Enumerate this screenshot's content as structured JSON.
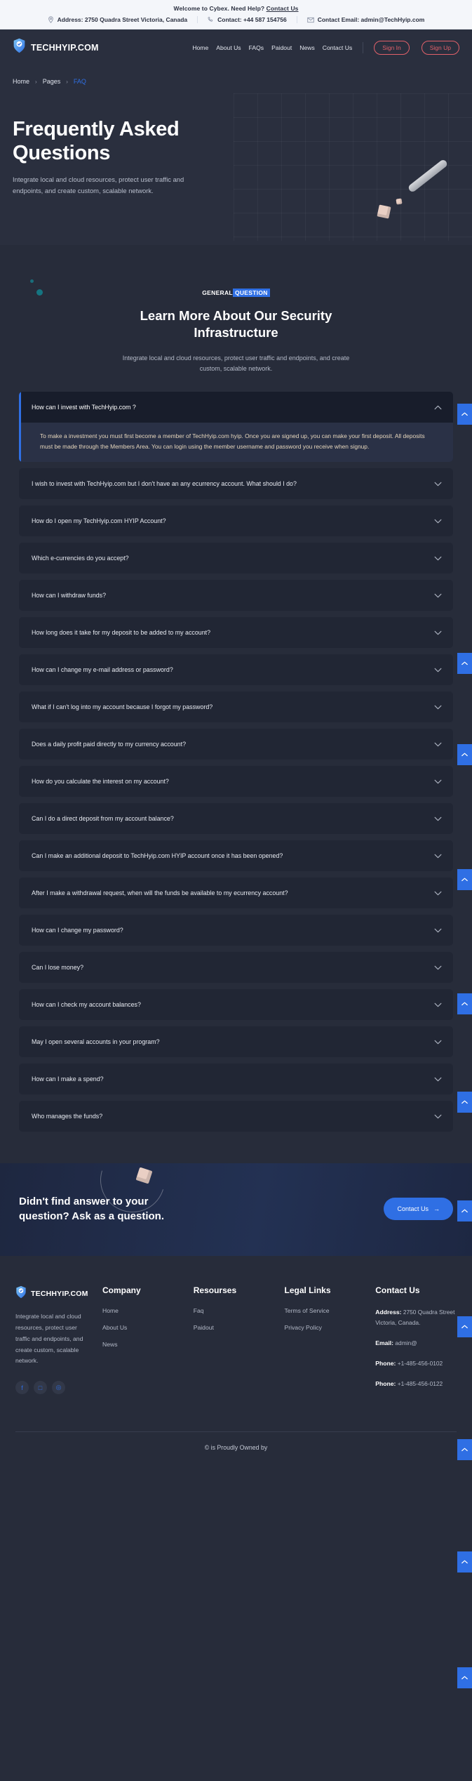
{
  "topbar": {
    "welcome_text": "Welcome to Cybex. Need Help?",
    "welcome_link": "Contact Us",
    "address": "Address: 2750 Quadra Street Victoria, Canada",
    "contact": "Contact: +44 587 154756",
    "email": "Contact Email: admin@TechHyip.com"
  },
  "header": {
    "brand": "TECHHYIP.COM",
    "nav": [
      {
        "label": "Home"
      },
      {
        "label": "About Us"
      },
      {
        "label": "FAQs"
      },
      {
        "label": "Paidout"
      },
      {
        "label": "News"
      },
      {
        "label": "Contact Us"
      }
    ],
    "sign_in": "Sign In",
    "sign_up": "Sign Up"
  },
  "hero": {
    "breadcrumb": [
      {
        "label": "Home"
      },
      {
        "label": "Pages"
      },
      {
        "label": "FAQ"
      }
    ],
    "separator": "›",
    "title": "Frequently Asked Questions",
    "subtitle": "Integrate local and cloud resources, protect user traffic and endpoints, and create custom, scalable network."
  },
  "faq": {
    "badge_prefix": "GENERAL",
    "badge_highlight": "QUESTION",
    "section_title": "Learn More About Our Security Infrastructure",
    "section_subtitle": "Integrate local and cloud resources, protect user traffic and endpoints, and create custom, scalable network.",
    "items": [
      {
        "question": "How can I invest with TechHyip.com ?",
        "open": true,
        "answer": "To make a investment you must first become a member of TechHyip.com hyip. Once you are signed up, you can make your first deposit. All deposits must be made through the Members Area. You can login using the member username and password you receive when signup."
      },
      {
        "question": "I wish to invest with TechHyip.com but I don't have an any ecurrency account. What should I do?",
        "open": false,
        "answer": ""
      },
      {
        "question": "How do I open my TechHyip.com HYIP Account?",
        "open": false,
        "answer": ""
      },
      {
        "question": "Which e-currencies do you accept?",
        "open": false,
        "answer": ""
      },
      {
        "question": "How can I withdraw funds?",
        "open": false,
        "answer": ""
      },
      {
        "question": "How long does it take for my deposit to be added to my account?",
        "open": false,
        "answer": ""
      },
      {
        "question": "How can I change my e-mail address or password?",
        "open": false,
        "answer": ""
      },
      {
        "question": "What if I can't log into my account because I forgot my password?",
        "open": false,
        "answer": ""
      },
      {
        "question": "Does a daily profit paid directly to my currency account?",
        "open": false,
        "answer": ""
      },
      {
        "question": "How do you calculate the interest on my account?",
        "open": false,
        "answer": ""
      },
      {
        "question": "Can I do a direct deposit from my account balance?",
        "open": false,
        "answer": ""
      },
      {
        "question": "Can I make an additional deposit to TechHyip.com HYIP account once it has been opened?",
        "open": false,
        "answer": ""
      },
      {
        "question": "After I make a withdrawal request, when will the funds be available to my ecurrency account?",
        "open": false,
        "answer": ""
      },
      {
        "question": "How can I change my password?",
        "open": false,
        "answer": ""
      },
      {
        "question": "Can I lose money?",
        "open": false,
        "answer": ""
      },
      {
        "question": "How can I check my account balances?",
        "open": false,
        "answer": ""
      },
      {
        "question": "May I open several accounts in your program?",
        "open": false,
        "answer": ""
      },
      {
        "question": "How can I make a spend?",
        "open": false,
        "answer": ""
      },
      {
        "question": "Who manages the funds?",
        "open": false,
        "answer": ""
      }
    ]
  },
  "cta": {
    "title": "Didn't find answer to your question? Ask as a question.",
    "button": "Contact Us",
    "button_arrow": "→"
  },
  "footer": {
    "brand": "TECHHYIP.COM",
    "about": "Integrate local and cloud resources, protect user traffic and endpoints, and create custom, scalable network.",
    "company": {
      "title": "Company",
      "links": [
        {
          "label": "Home"
        },
        {
          "label": "About Us"
        },
        {
          "label": "News"
        }
      ]
    },
    "resources": {
      "title": "Resourses",
      "links": [
        {
          "label": "Faq"
        },
        {
          "label": "Paidout"
        }
      ]
    },
    "legal": {
      "title": "Legal Links",
      "links": [
        {
          "label": "Terms of Service"
        },
        {
          "label": "Privacy Policy"
        }
      ]
    },
    "contact": {
      "title": "Contact Us",
      "address_label": "Address:",
      "address_value": "2750 Quadra Street Victoria, Canada.",
      "email_label": "Email:",
      "email_value": "admin@",
      "phone1_label": "Phone:",
      "phone1_value": "+1-485-456-0102",
      "phone2_label": "Phone:",
      "phone2_value": "+1-485-456-0122"
    },
    "socials": [
      {
        "name": "facebook-icon",
        "glyph": "f"
      },
      {
        "name": "twitch-icon",
        "glyph": "□"
      },
      {
        "name": "instagram-icon",
        "glyph": "◎"
      }
    ],
    "copyright": "© is Proudly Owned by"
  },
  "colors": {
    "accent": "#2f6fe4",
    "page_bg": "#272c3a",
    "header_bg": "#2a2f3e",
    "answer_text": "#e7d7bd",
    "signin_border": "#e2616a"
  }
}
